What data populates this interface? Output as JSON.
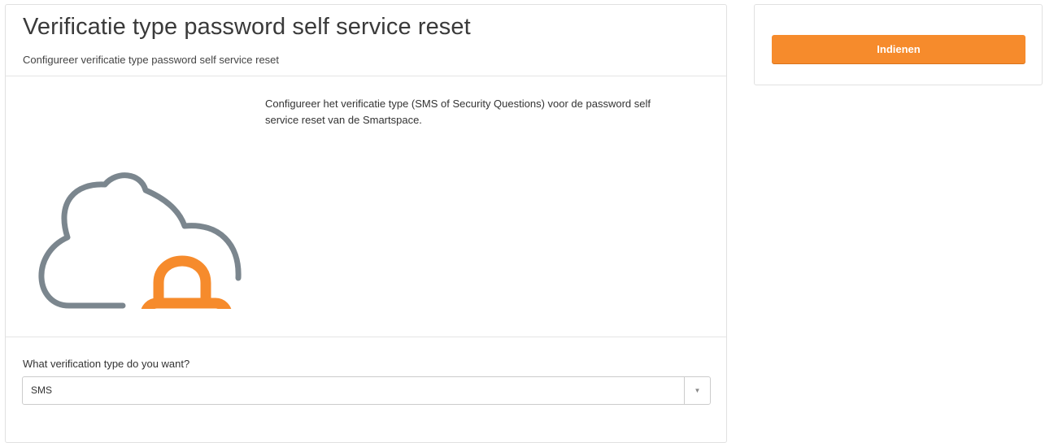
{
  "header": {
    "title": "Verificatie type password self service reset",
    "subtitle": "Configureer verificatie type password self service reset"
  },
  "body": {
    "description": "Configureer het verificatie type (SMS of Security Questions) voor de password self service reset van de Smartspace.",
    "illustration": {
      "icons": [
        "cloud-icon",
        "padlock-icon"
      ],
      "colors": {
        "cloud": "#7b868e",
        "padlock": "#f68b2c"
      }
    }
  },
  "form": {
    "label": "What verification type do you want?",
    "selected_value": "SMS",
    "arrow_glyph": "▼"
  },
  "sidebar": {
    "submit_label": "Indienen"
  },
  "theme": {
    "accent": "#f68b2c"
  }
}
